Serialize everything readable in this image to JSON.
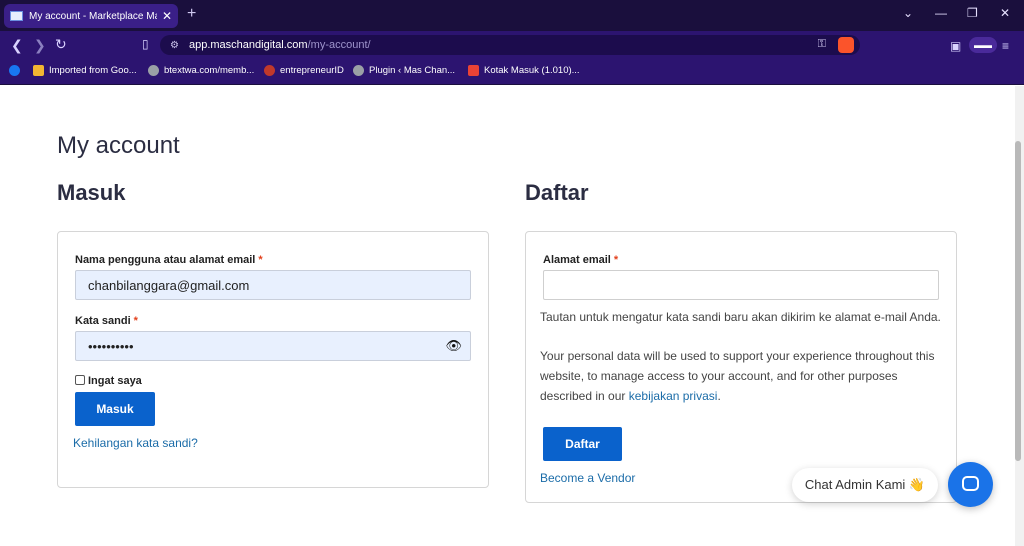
{
  "browser": {
    "tab_title": "My account - Marketplace Mas",
    "new_tab_icon": "plus-icon",
    "url_host": "app.maschandigital.com",
    "url_path": "/my-account/",
    "window_controls": [
      "chevron-down",
      "minimize",
      "restore",
      "close"
    ],
    "bookmarks": [
      {
        "label": "Imported from Goo...",
        "icon": "folder-icon",
        "color": "#f2b632"
      },
      {
        "label": "btextwa.com/memb...",
        "icon": "globe-icon",
        "color": "#9aa0a6"
      },
      {
        "label": "entrepreneurID",
        "icon": "site-icon",
        "color": "#c0392b"
      },
      {
        "label": "Plugin ‹ Mas Chan...",
        "icon": "globe-icon",
        "color": "#9aa0a6"
      },
      {
        "label": "Kotak Masuk (1.010)...",
        "icon": "gmail-icon",
        "color": "#ea4335"
      }
    ]
  },
  "page": {
    "title": "My account",
    "login": {
      "heading": "Masuk",
      "username_label": "Nama pengguna atau alamat email",
      "username_value": "chanbilanggara@gmail.com",
      "password_label": "Kata sandi",
      "password_value": "••••••••••",
      "remember_label": "Ingat saya",
      "submit_label": "Masuk",
      "lost_password": "Kehilangan kata sandi?"
    },
    "register": {
      "heading": "Daftar",
      "email_label": "Alamat email",
      "email_value": "",
      "notice": "Tautan untuk mengatur kata sandi baru akan dikirim ke alamat e-mail Anda.",
      "privacy_line1": "Your personal data will be used to support your experience throughout this",
      "privacy_line2": "website, to manage access to your account, and for other purposes",
      "privacy_line3_pre": "described in our ",
      "privacy_link": "kebijakan privasi",
      "privacy_line3_post": ".",
      "submit_label": "Daftar",
      "vendor_link": "Become a Vendor"
    },
    "required_mark": "*"
  },
  "chat": {
    "label": "Chat Admin Kami 👋"
  },
  "colors": {
    "accent": "#0a62cc",
    "link": "#1b6ca8",
    "required": "#e2401c",
    "chrome": "#2c1470"
  }
}
